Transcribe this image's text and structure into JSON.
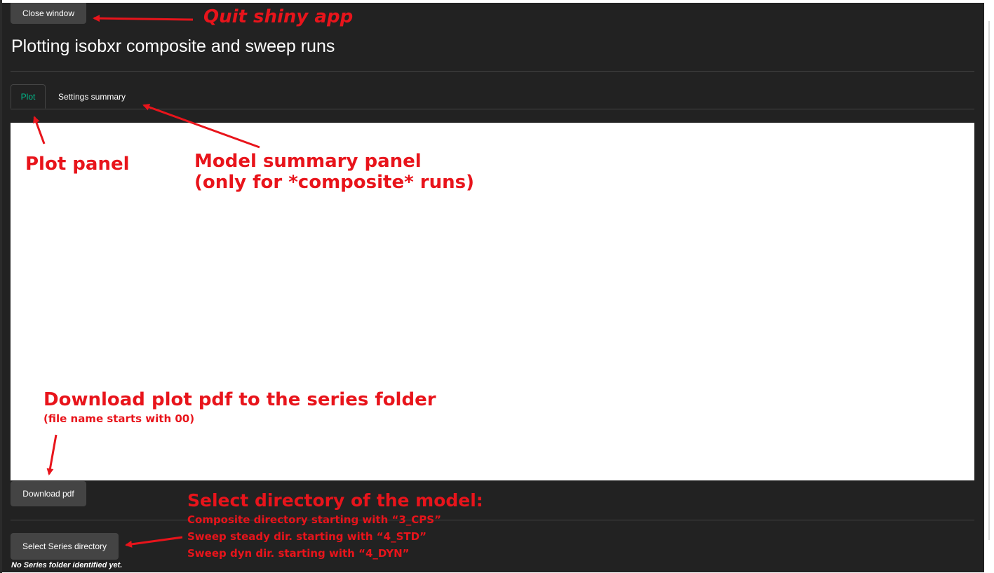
{
  "buttons": {
    "close": "Close window",
    "download": "Download pdf",
    "select_series": "Select Series directory"
  },
  "app_title": "Plotting isobxr composite and sweep runs",
  "tabs": [
    {
      "label": "Plot",
      "active": true
    },
    {
      "label": "Settings summary",
      "active": false
    }
  ],
  "status": "No Series folder identified yet.",
  "annotations": {
    "quit": "Quit shiny app",
    "plot_panel": "Plot panel",
    "model_summary_line1": "Model summary panel",
    "model_summary_line2": "(only for *composite* runs)",
    "download_line1": "Download plot pdf to the series folder",
    "download_line2": "(file name starts with 00)",
    "select_title": "Select directory of the model:",
    "select_line1": "Composite directory starting with “3_CPS”",
    "select_line2": "Sweep steady dir. starting with “4_STD”",
    "select_line3": "Sweep dyn dir. starting with “4_DYN”"
  },
  "colors": {
    "background": "#222222",
    "button": "#444444",
    "active_tab": "#00bc8c",
    "annotation": "#e8141b"
  }
}
